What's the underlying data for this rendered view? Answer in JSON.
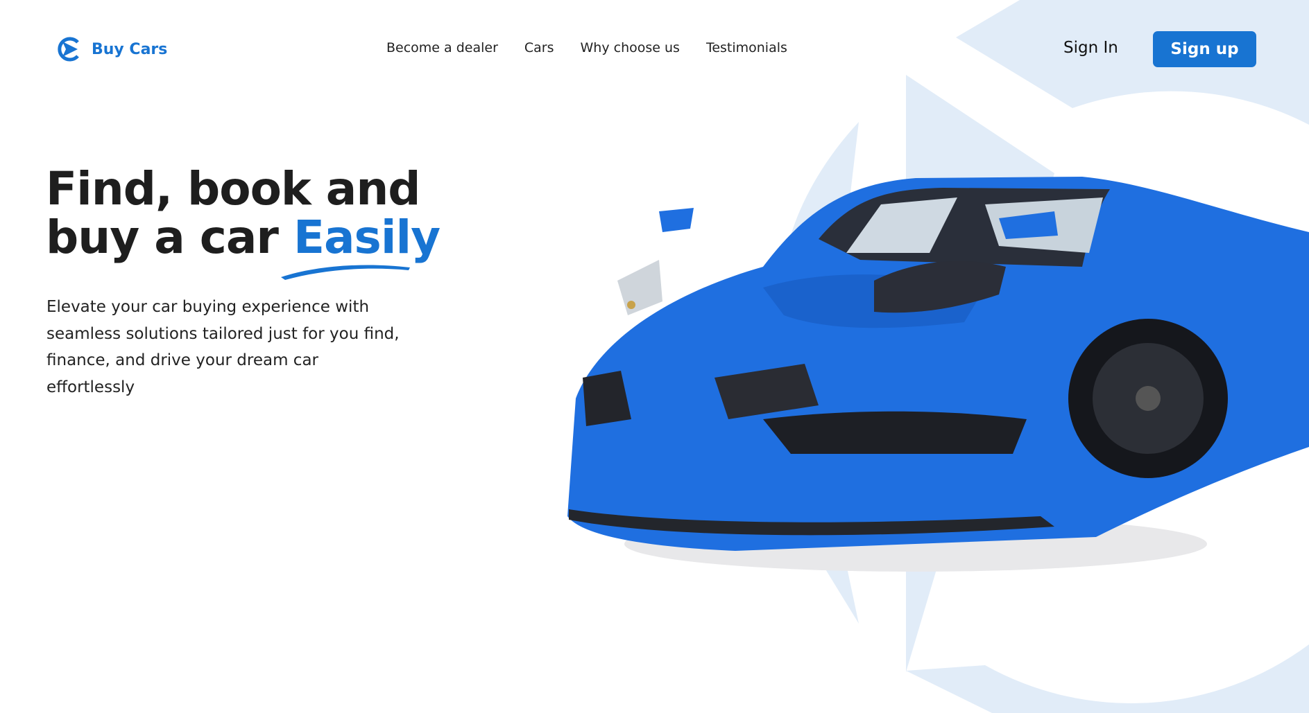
{
  "brand": {
    "name": "Buy Cars",
    "icon": "play-logo-icon"
  },
  "nav": {
    "items": [
      "Become a dealer",
      "Cars",
      "Why choose us",
      "Testimonials"
    ]
  },
  "auth": {
    "sign_in": "Sign In",
    "sign_up": "Sign up"
  },
  "hero": {
    "title_line1": "Find, book and",
    "title_line2_prefix": "buy a car ",
    "title_highlight": "Easily",
    "description": "Elevate your car buying experience with seamless solutions tailored just for you find, finance, and drive your dream car effortlessly"
  },
  "colors": {
    "accent": "#1874d2",
    "background_shape": "#e1ecf8",
    "car": "#1f6fe0"
  }
}
